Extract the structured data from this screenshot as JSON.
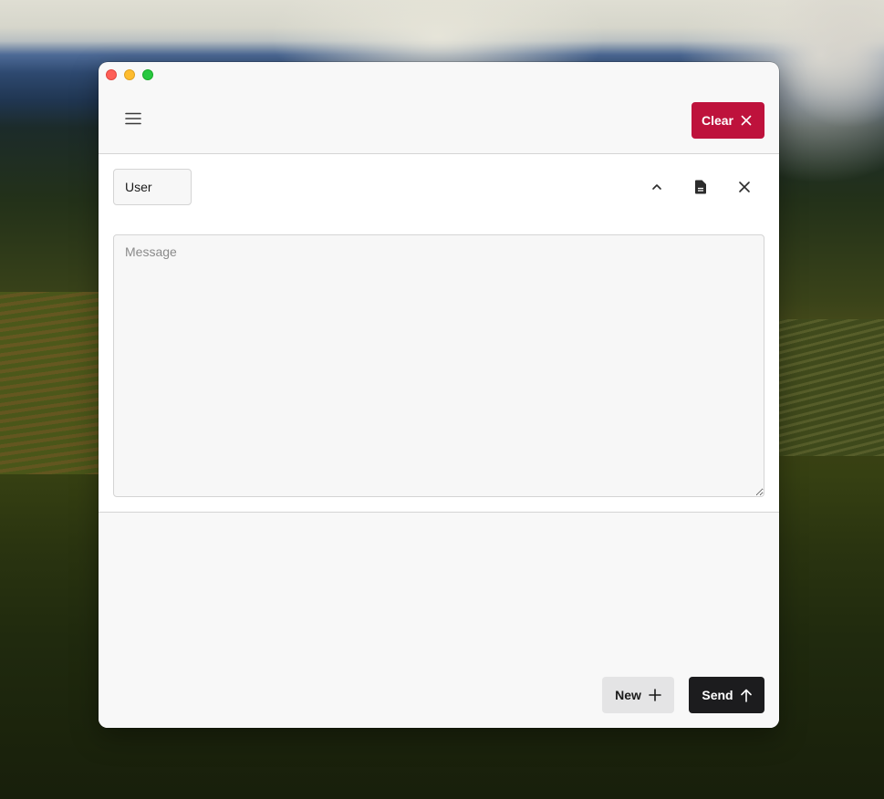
{
  "window": {
    "controls": [
      "close",
      "minimize",
      "maximize"
    ]
  },
  "header": {
    "menu_icon": "hamburger-menu-icon",
    "clear_label": "Clear",
    "clear_icon": "close-icon",
    "clear_color": "#be123c"
  },
  "message": {
    "role": "User",
    "role_options_visible": [
      "User"
    ],
    "actions": [
      {
        "name": "collapse",
        "icon": "chevron-up-icon"
      },
      {
        "name": "document",
        "icon": "document-icon"
      },
      {
        "name": "remove",
        "icon": "close-icon"
      }
    ],
    "input_value": "",
    "input_placeholder": "Message"
  },
  "footer": {
    "new_label": "New",
    "new_icon": "plus-icon",
    "send_label": "Send",
    "send_icon": "arrow-up-icon",
    "send_color": "#1c1c1e"
  }
}
